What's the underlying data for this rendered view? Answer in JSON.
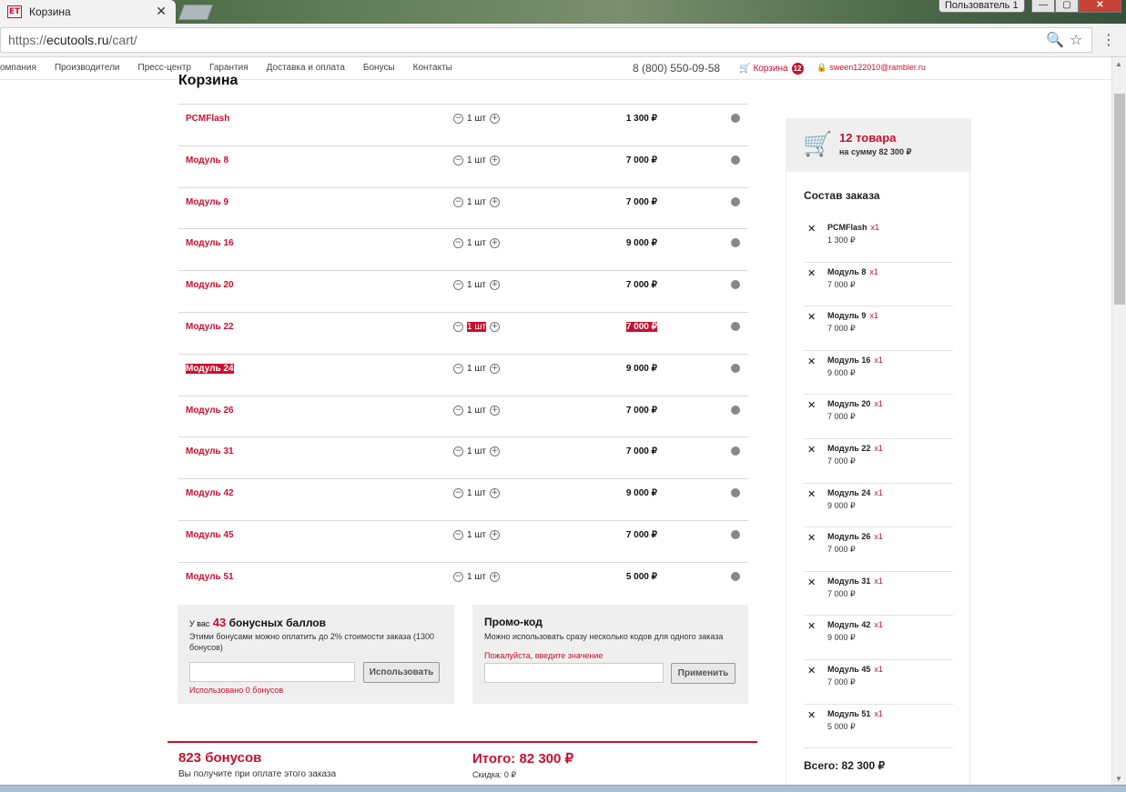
{
  "browser": {
    "tab_title": "Корзина",
    "favicon_text": "ET",
    "profile": "Пользователь 1",
    "url_scheme": "https://",
    "url_host": "ecutools.ru",
    "url_path": "/cart/"
  },
  "nav": {
    "items": [
      "омпания",
      "Производители",
      "Пресс-центр",
      "Гарантия",
      "Доставка и оплата",
      "Бонусы",
      "Контакты"
    ],
    "phone": "8 (800) 550-09-58",
    "cart_label": "Корзина",
    "cart_count": "12",
    "user_email": "sween122010@rambler.ru"
  },
  "page_title": "Корзина",
  "cart": {
    "qty_text": "1 шт",
    "items": [
      {
        "name": "PCMFlash",
        "price": "1 300 ₽"
      },
      {
        "name": "Модуль 8",
        "price": "7 000 ₽"
      },
      {
        "name": "Модуль 9",
        "price": "7 000 ₽"
      },
      {
        "name": "Модуль 16",
        "price": "9 000 ₽"
      },
      {
        "name": "Модуль 20",
        "price": "7 000 ₽"
      },
      {
        "name": "Модуль 22",
        "price": "7 000 ₽"
      },
      {
        "name": "Модуль 24",
        "price": "9 000 ₽"
      },
      {
        "name": "Модуль 26",
        "price": "7 000 ₽"
      },
      {
        "name": "Модуль 31",
        "price": "7 000 ₽"
      },
      {
        "name": "Модуль 42",
        "price": "9 000 ₽"
      },
      {
        "name": "Модуль 45",
        "price": "7 000 ₽"
      },
      {
        "name": "Модуль 51",
        "price": "5 000 ₽"
      }
    ]
  },
  "bonus": {
    "prefix": "У вас",
    "points": "43",
    "suffix": "бонусных баллов",
    "desc": "Этими бонусами можно оплатить до 2% стоимости заказа (1300 бонусов)",
    "button": "Использовать",
    "used_note": "Использовано 0 бонусов",
    "input_value": ""
  },
  "promo": {
    "title": "Промо-код",
    "desc": "Можно использовать сразу несколько кодов для одного заказа",
    "error": "Пожалуйста, введите значение",
    "button": "Применить",
    "input_value": ""
  },
  "totals": {
    "bonus_earned": "823 бонусов",
    "bonus_note": "Вы получите при оплате этого заказа",
    "grand_total": "Итого: 82 300 ₽",
    "discount": "Скидка: 0 ₽"
  },
  "sidebar": {
    "count": "12 товара",
    "sum": "на сумму 82 300 ₽",
    "title": "Состав заказа",
    "mult": "x1",
    "total": "Всего: 82 300 ₽",
    "items": [
      {
        "name": "PCMFlash",
        "price": "1 300 ₽"
      },
      {
        "name": "Модуль 8",
        "price": "7 000 ₽"
      },
      {
        "name": "Модуль 9",
        "price": "7 000 ₽"
      },
      {
        "name": "Модуль 16",
        "price": "9 000 ₽"
      },
      {
        "name": "Модуль 20",
        "price": "7 000 ₽"
      },
      {
        "name": "Модуль 22",
        "price": "7 000 ₽"
      },
      {
        "name": "Модуль 24",
        "price": "9 000 ₽"
      },
      {
        "name": "Модуль 26",
        "price": "7 000 ₽"
      },
      {
        "name": "Модуль 31",
        "price": "7 000 ₽"
      },
      {
        "name": "Модуль 42",
        "price": "9 000 ₽"
      },
      {
        "name": "Модуль 45",
        "price": "7 000 ₽"
      },
      {
        "name": "Модуль 51",
        "price": "5 000 ₽"
      }
    ]
  },
  "colors": {
    "accent": "#c8102e",
    "panel_bg": "#efefef"
  }
}
